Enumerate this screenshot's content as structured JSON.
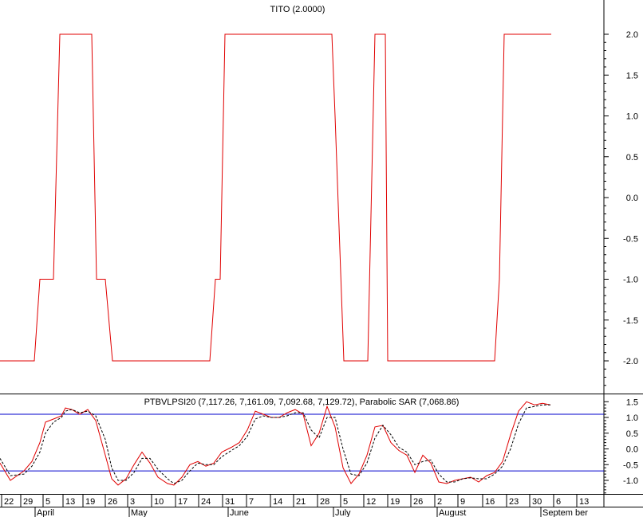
{
  "colors": {
    "background": "#ffffff",
    "axis": "#000000",
    "price_line": "#e00000",
    "sar_line": "#000000",
    "reference_line": "#0000cc"
  },
  "chart_data": [
    {
      "type": "line",
      "title": "TITO (2.0000)",
      "ylim": [
        -2.4,
        2.4
      ],
      "y_ticks": [
        "2.0",
        "1.5",
        "1.0",
        "0.5",
        "0.0",
        "-0.5",
        "-1.0",
        "-1.5",
        "-2.0"
      ],
      "grid": false,
      "series": [
        {
          "x": [
            0,
            43,
            50,
            67,
            75,
            115,
            121,
            132,
            141,
            263,
            270,
            276,
            282,
            416,
            420,
            431,
            461,
            470,
            483,
            486,
            496,
            620,
            626,
            632,
            691
          ],
          "values": [
            -2,
            -2,
            -1,
            -1,
            2,
            2,
            -1,
            -1,
            -2,
            -2,
            -1,
            -1,
            2,
            2,
            1,
            -2,
            -2,
            2,
            2,
            -2,
            -2,
            -2,
            -1,
            2,
            2
          ]
        }
      ]
    },
    {
      "type": "line",
      "title": "PTBVLPSI20 (7,117.26, 7,161.09, 7,092.68, 7,129.72), Parabolic SAR (7,068.86)",
      "ylim": [
        -1.35,
        1.65
      ],
      "y_ticks": [
        "1.5",
        "1.0",
        "0.5",
        "0.0",
        "-0.5",
        "-1.0"
      ],
      "reference_lines": [
        1.1,
        -0.7
      ],
      "series": [
        {
          "x": [
            0,
            13,
            30,
            40,
            50,
            57,
            67,
            77,
            82,
            90,
            100,
            110,
            120,
            132,
            140,
            148,
            158,
            168,
            178,
            188,
            198,
            210,
            218,
            228,
            238,
            248,
            258,
            268,
            278,
            290,
            300,
            310,
            320,
            330,
            340,
            350,
            360,
            370,
            380,
            390,
            400,
            410,
            420,
            430,
            440,
            450,
            460,
            470,
            480,
            490,
            500,
            510,
            520,
            530,
            540,
            550,
            560,
            570,
            580,
            590,
            600,
            610,
            620,
            630,
            640,
            650,
            660,
            670,
            680,
            690
          ],
          "values": [
            -0.45,
            -1.0,
            -0.7,
            -0.4,
            0.2,
            0.85,
            0.95,
            1.05,
            1.3,
            1.25,
            1.1,
            1.25,
            0.9,
            -0.2,
            -0.95,
            -1.15,
            -0.95,
            -0.5,
            -0.1,
            -0.45,
            -0.9,
            -1.1,
            -1.15,
            -0.9,
            -0.5,
            -0.4,
            -0.55,
            -0.45,
            -0.1,
            0.05,
            0.2,
            0.6,
            1.2,
            1.1,
            1.0,
            1.0,
            1.15,
            1.25,
            1.1,
            0.1,
            0.5,
            1.35,
            0.7,
            -0.6,
            -1.1,
            -0.8,
            -0.2,
            0.7,
            0.75,
            0.2,
            -0.05,
            -0.2,
            -0.75,
            -0.2,
            -0.45,
            -1.05,
            -1.1,
            -1.0,
            -0.95,
            -0.9,
            -1.05,
            -0.85,
            -0.75,
            -0.4,
            0.45,
            1.2,
            1.5,
            1.4,
            1.45,
            1.4
          ]
        },
        {
          "style": "dashed",
          "x": [
            0,
            13,
            30,
            40,
            50,
            57,
            67,
            77,
            82,
            90,
            100,
            110,
            120,
            132,
            140,
            148,
            158,
            168,
            178,
            188,
            198,
            210,
            218,
            228,
            238,
            248,
            258,
            268,
            278,
            290,
            300,
            310,
            320,
            330,
            340,
            350,
            360,
            370,
            380,
            390,
            400,
            410,
            420,
            430,
            440,
            450,
            460,
            470,
            480,
            490,
            500,
            510,
            520,
            530,
            540,
            550,
            560,
            570,
            580,
            590,
            600,
            610,
            620,
            630,
            640,
            650,
            660,
            670,
            680,
            690
          ],
          "values": [
            -0.3,
            -0.85,
            -0.8,
            -0.55,
            -0.1,
            0.5,
            0.85,
            1.0,
            1.2,
            1.25,
            1.15,
            1.2,
            1.05,
            0.3,
            -0.6,
            -1.0,
            -1.0,
            -0.75,
            -0.3,
            -0.3,
            -0.65,
            -0.95,
            -1.1,
            -1.0,
            -0.7,
            -0.45,
            -0.5,
            -0.5,
            -0.25,
            -0.05,
            0.1,
            0.4,
            0.95,
            1.05,
            1.0,
            1.0,
            1.05,
            1.15,
            1.15,
            0.6,
            0.35,
            1.0,
            1.0,
            0.0,
            -0.8,
            -0.85,
            -0.45,
            0.35,
            0.75,
            0.45,
            0.05,
            -0.1,
            -0.5,
            -0.4,
            -0.35,
            -0.8,
            -1.05,
            -1.05,
            -0.95,
            -0.92,
            -0.95,
            -0.95,
            -0.8,
            -0.55,
            0.0,
            0.8,
            1.3,
            1.35,
            1.4,
            1.4
          ]
        }
      ]
    }
  ],
  "x_axis": {
    "day_ticks": [
      "22",
      "29",
      "5",
      "13",
      "19",
      "26",
      "3",
      "10",
      "17",
      "24",
      "31",
      "7",
      "14",
      "21",
      "28",
      "5",
      "12",
      "19",
      "26",
      "2",
      "9",
      "16",
      "23",
      "30",
      "6",
      "13"
    ],
    "month_labels": [
      "April",
      "May",
      "June",
      "July",
      "August",
      "Septem ber"
    ]
  }
}
